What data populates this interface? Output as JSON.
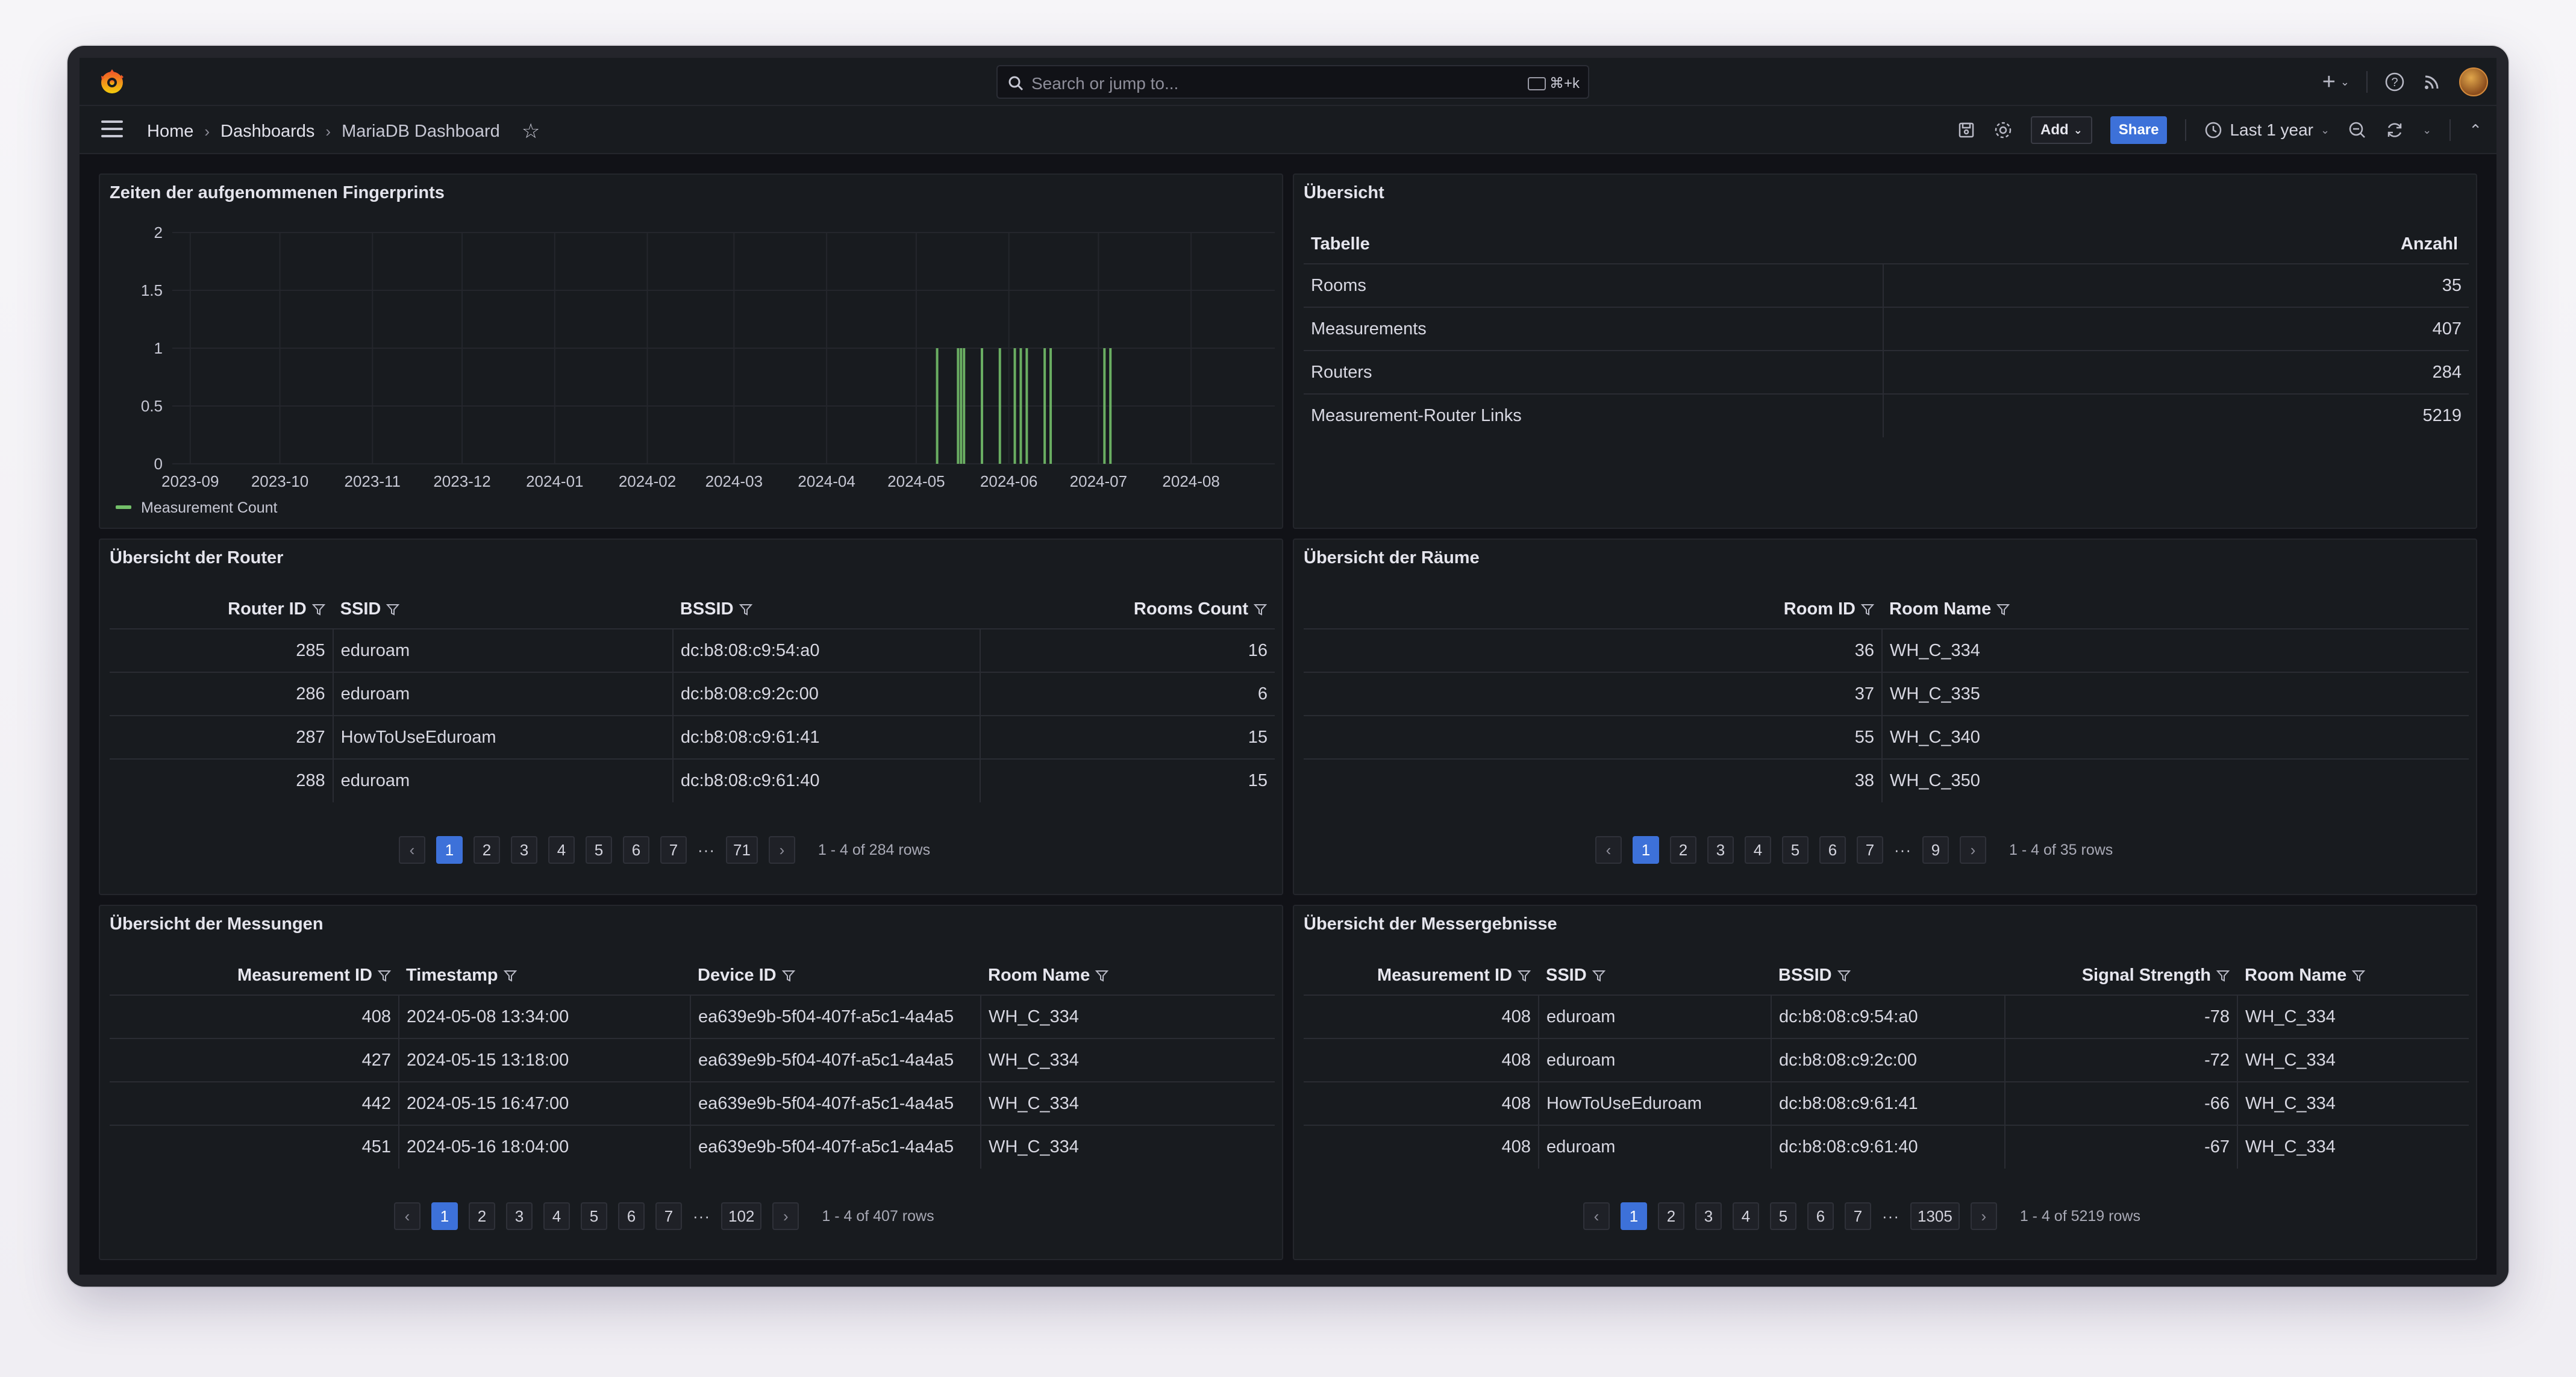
{
  "topbar": {
    "search_placeholder": "Search or jump to...",
    "shortcut": "⌘+k",
    "icons": [
      "grafana-logo-icon",
      "search-icon",
      "plus-icon",
      "help-icon",
      "rss-icon",
      "avatar"
    ]
  },
  "nav": {
    "breadcrumbs": [
      "Home",
      "Dashboards",
      "MariaDB Dashboard"
    ],
    "add_label": "Add",
    "share_label": "Share",
    "time_range": "Last 1 year"
  },
  "chart_panel": {
    "title": "Zeiten der aufgenommenen Fingerprints"
  },
  "chart_data": {
    "type": "bar",
    "x_tick_labels": [
      "2023-09",
      "2023-10",
      "2023-11",
      "2023-12",
      "2024-01",
      "2024-02",
      "2024-03",
      "2024-04",
      "2024-05",
      "2024-06",
      "2024-07",
      "2024-08"
    ],
    "y_ticks": [
      0,
      0.5,
      1,
      1.5,
      2
    ],
    "ylim": [
      0,
      2
    ],
    "series": [
      {
        "name": "Measurement Count",
        "color": "#73bf69",
        "x": [
          "2024-05-08",
          "2024-05-15",
          "2024-05-16",
          "2024-05-17",
          "2024-05-23",
          "2024-05-29",
          "2024-06-03",
          "2024-06-05",
          "2024-06-07",
          "2024-06-13",
          "2024-06-15",
          "2024-07-03",
          "2024-07-05"
        ],
        "values": [
          1,
          1,
          1,
          1,
          1,
          1,
          1,
          1,
          1,
          1,
          1,
          1,
          1
        ]
      }
    ],
    "legend": "bottom-left",
    "grid": true
  },
  "overview_panel": {
    "title": "Übersicht",
    "headers": [
      "Tabelle",
      "Anzahl"
    ],
    "rows": [
      [
        "Rooms",
        "35"
      ],
      [
        "Measurements",
        "407"
      ],
      [
        "Routers",
        "284"
      ],
      [
        "Measurement-Router Links",
        "5219"
      ]
    ]
  },
  "router_panel": {
    "title": "Übersicht der Router",
    "headers": [
      "Router ID",
      "SSID",
      "BSSID",
      "Rooms Count"
    ],
    "rows": [
      [
        "285",
        "eduroam",
        "dc:b8:08:c9:54:a0",
        "16"
      ],
      [
        "286",
        "eduroam",
        "dc:b8:08:c9:2c:00",
        "6"
      ],
      [
        "287",
        "HowToUseEduroam",
        "dc:b8:08:c9:61:41",
        "15"
      ],
      [
        "288",
        "eduroam",
        "dc:b8:08:c9:61:40",
        "15"
      ]
    ],
    "pages": [
      "1",
      "2",
      "3",
      "4",
      "5",
      "6",
      "7",
      "71"
    ],
    "info": "1 - 4 of 284 rows"
  },
  "rooms_panel": {
    "title": "Übersicht der Räume",
    "headers": [
      "Room ID",
      "Room Name"
    ],
    "rows": [
      [
        "36",
        "WH_C_334"
      ],
      [
        "37",
        "WH_C_335"
      ],
      [
        "55",
        "WH_C_340"
      ],
      [
        "38",
        "WH_C_350"
      ]
    ],
    "pages": [
      "1",
      "2",
      "3",
      "4",
      "5",
      "6",
      "7",
      "9"
    ],
    "info": "1 - 4 of 35 rows"
  },
  "measurements_panel": {
    "title": "Übersicht der Messungen",
    "headers": [
      "Measurement ID",
      "Timestamp",
      "Device ID",
      "Room Name"
    ],
    "rows": [
      [
        "408",
        "2024-05-08 13:34:00",
        "ea639e9b-5f04-407f-a5c1-4a4a5",
        "WH_C_334"
      ],
      [
        "427",
        "2024-05-15 13:18:00",
        "ea639e9b-5f04-407f-a5c1-4a4a5",
        "WH_C_334"
      ],
      [
        "442",
        "2024-05-15 16:47:00",
        "ea639e9b-5f04-407f-a5c1-4a4a5",
        "WH_C_334"
      ],
      [
        "451",
        "2024-05-16 18:04:00",
        "ea639e9b-5f04-407f-a5c1-4a4a5",
        "WH_C_334"
      ]
    ],
    "pages": [
      "1",
      "2",
      "3",
      "4",
      "5",
      "6",
      "7",
      "102"
    ],
    "info": "1 - 4 of 407 rows"
  },
  "results_panel": {
    "title": "Übersicht der Messergebnisse",
    "headers": [
      "Measurement ID",
      "SSID",
      "BSSID",
      "Signal Strength",
      "Room Name"
    ],
    "rows": [
      [
        "408",
        "eduroam",
        "dc:b8:08:c9:54:a0",
        "-78",
        "WH_C_334"
      ],
      [
        "408",
        "eduroam",
        "dc:b8:08:c9:2c:00",
        "-72",
        "WH_C_334"
      ],
      [
        "408",
        "HowToUseEduroam",
        "dc:b8:08:c9:61:41",
        "-66",
        "WH_C_334"
      ],
      [
        "408",
        "eduroam",
        "dc:b8:08:c9:61:40",
        "-67",
        "WH_C_334"
      ]
    ],
    "pages": [
      "1",
      "2",
      "3",
      "4",
      "5",
      "6",
      "7",
      "1305"
    ],
    "info": "1 - 4 of 5219 rows"
  }
}
